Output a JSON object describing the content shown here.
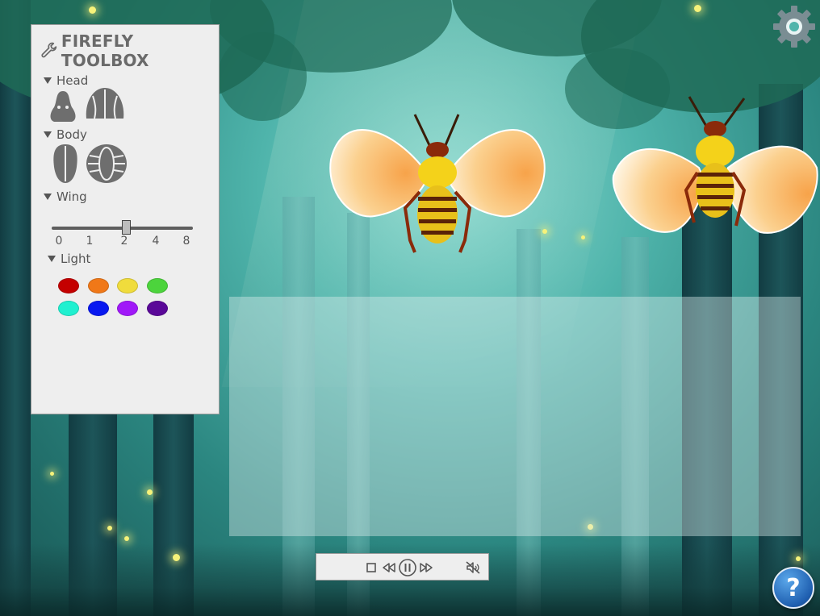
{
  "toolbox": {
    "title": "FIREFLY TOOLBOX",
    "sections": {
      "head": "Head",
      "body": "Body",
      "wing": "Wing",
      "light": "Light"
    },
    "wing_slider": {
      "ticks": [
        "0",
        "1",
        "2",
        "4",
        "8"
      ],
      "selected": "2"
    },
    "light_colors": [
      "#c40000",
      "#f07818",
      "#f0dc3c",
      "#4cd43c",
      "#20f0d0",
      "#0818f0",
      "#a018f8",
      "#5a0898"
    ]
  },
  "icons": {
    "settings": "gear-icon",
    "help_label": "?",
    "toolbox": "wrench-icon",
    "playback": [
      "stop-icon",
      "rewind-icon",
      "pause-icon",
      "fast-forward-icon",
      "mute-icon"
    ]
  },
  "colors": {
    "panel_bg": "#eeeeee",
    "panel_text": "#555555",
    "shape_fill": "#6e6e6e",
    "gear": "#7a8d93",
    "help": "#1f5fb0"
  }
}
